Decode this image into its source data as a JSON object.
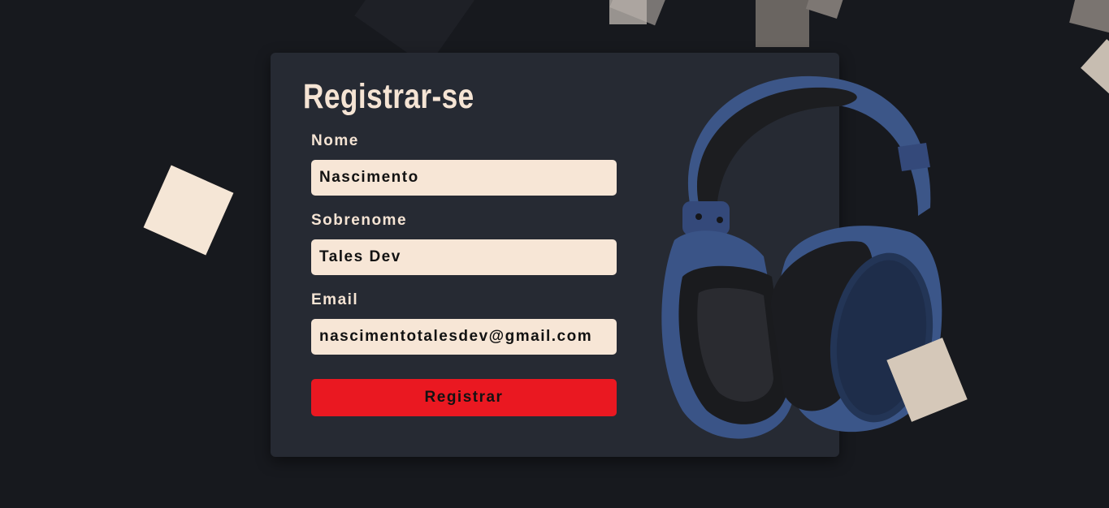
{
  "form": {
    "title": "Registrar-se",
    "fields": [
      {
        "label": "Nome",
        "value": "Nascimento"
      },
      {
        "label": "Sobrenome",
        "value": "Tales Dev"
      },
      {
        "label": "Email",
        "value": "nascimentotalesdev@gmail.com"
      }
    ],
    "submit_label": "Registrar"
  },
  "colors": {
    "background": "#17191e",
    "card": "#262a33",
    "input": "#f7e6d6",
    "accent": "#ea1821",
    "text_light": "#f5e4d4"
  },
  "illustration": {
    "icon": "headphones-icon"
  }
}
